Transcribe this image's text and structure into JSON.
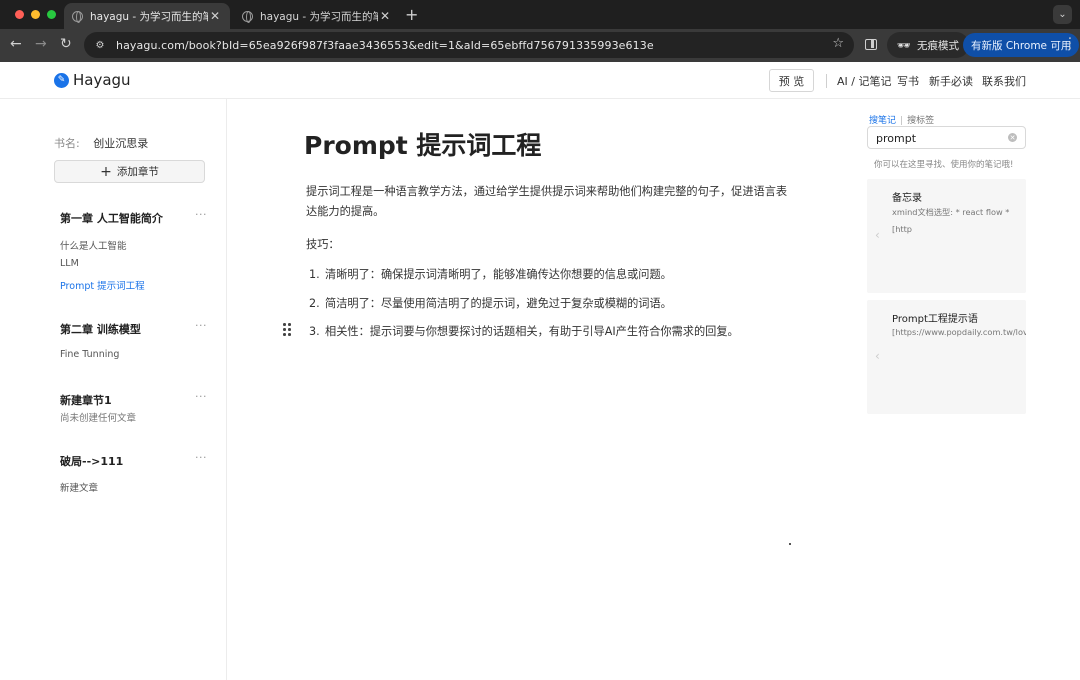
{
  "browser": {
    "tabs": [
      {
        "title": "hayagu - 为学习而生的笔记工具"
      },
      {
        "title": "hayagu - 为学习而生的笔记工具"
      }
    ],
    "url": "hayagu.com/book?bId=65ea926f987f3faae3436553&edit=1&aId=65ebffd756791335993e613e",
    "incognito_label": "无痕模式",
    "update_label": "有新版 Chrome 可用"
  },
  "header": {
    "logo_text": "Hayagu",
    "preview_label": "预 览",
    "nav": [
      "AI / 记笔记",
      "写书",
      "新手必读",
      "联系我们"
    ]
  },
  "sidebar": {
    "book_label": "书名:",
    "book_name": "创业沉思录",
    "add_chapter_label": "添加章节",
    "chapters": [
      {
        "title": "第一章 人工智能简介",
        "articles": [
          "什么是人工智能",
          "LLM",
          "Prompt 提示词工程"
        ]
      },
      {
        "title": "第二章 训练模型",
        "articles": [
          "Fine Tunning"
        ]
      },
      {
        "title": "新建章节1",
        "articles": [
          "尚未创建任何文章"
        ]
      },
      {
        "title": "破局-->111",
        "articles": [
          "新建文章"
        ]
      }
    ],
    "more_symbol": "···"
  },
  "editor": {
    "title": "Prompt 提示词工程",
    "paragraph": "提示词工程是一种语言教学方法，通过给学生提供提示词来帮助他们构建完整的句子，促进语言表达能力的提高。",
    "tips_label": "技巧：",
    "list": [
      {
        "num": "1.",
        "text": "清晰明了：确保提示词清晰明了，能够准确传达你想要的信息或问题。"
      },
      {
        "num": "2.",
        "text": "简洁明了：尽量使用简洁明了的提示词，避免过于复杂或模糊的词语。"
      },
      {
        "num": "3.",
        "text": "相关性：提示词要与你想要探讨的话题相关，有助于引导AI产生符合你需求的回复。"
      }
    ]
  },
  "search_panel": {
    "tab_notes": "搜笔记",
    "tab_tags": "搜标签",
    "query": "prompt",
    "hint": "你可以在这里寻找、使用你的笔记哦!",
    "results": [
      {
        "title": "备忘录",
        "lines": [
          "xmind文档选型:   * react flow *",
          "[http"
        ]
      },
      {
        "title": "Prompt工程提示语",
        "lines": [
          "[https://www.popdaily.com.tw/love"
        ]
      }
    ]
  }
}
